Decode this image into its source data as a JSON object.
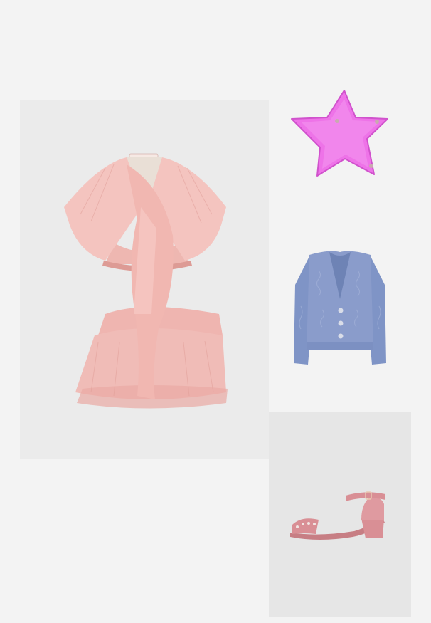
{
  "collage": {
    "background": "#f3f3f3",
    "items": [
      {
        "id": "dress",
        "icon": "tulle-ruffle-dress-icon",
        "color": "#f2c0bb",
        "tile_background": "#ebebeb"
      },
      {
        "id": "bag",
        "icon": "star-clutch-bag-icon",
        "color": "#ee6ee8",
        "tile_background": "#f3f3f3"
      },
      {
        "id": "cardigan",
        "icon": "knit-cardigan-icon",
        "color": "#8a9ccb",
        "tile_background": "#f3f3f3"
      },
      {
        "id": "sandal",
        "icon": "block-heel-sandal-icon",
        "color": "#d98f95",
        "tile_background": "#e6e6e6"
      }
    ]
  }
}
